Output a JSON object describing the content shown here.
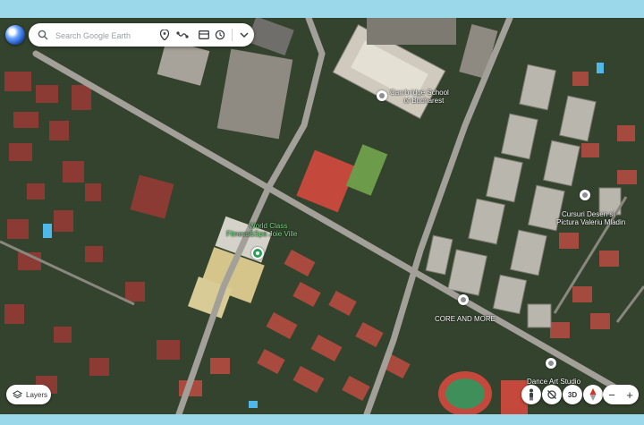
{
  "search": {
    "placeholder": "Search Google Earth"
  },
  "toolbar": {
    "icons": [
      "globe-icon",
      "search-icon",
      "place-marker-icon",
      "route-icon",
      "map-style-icon",
      "history-icon",
      "chevron-down-icon"
    ]
  },
  "places": [
    {
      "name": "Cambridge School\nof Bucharest",
      "line1": "Cambridge School",
      "line2": "of Bucharest",
      "pin": "gray"
    },
    {
      "name": "World Class Fitness&Spa Joie Ville",
      "line1": "World Class",
      "line2": "Fitness&Spa Joie Ville",
      "pin": "green"
    },
    {
      "name": "Cursuri Desen si Pictura Valeriu Mladin",
      "line1": "Cursuri Desen si",
      "line2": "Pictura Valeriu Mladin",
      "pin": "gray"
    },
    {
      "name": "CORE AND MORE",
      "line1": "CORE AND MORE",
      "line2": "",
      "pin": "gray"
    },
    {
      "name": "Dance Art Studio",
      "line1": "Dance Art Studio",
      "line2": "",
      "pin": "gray"
    }
  ],
  "controls": {
    "layers_label": "Layers",
    "view_3d_label": "3D",
    "zoom_out": "−",
    "zoom_in": "+",
    "icons": [
      "pegman-icon",
      "location-off-icon",
      "compass-icon"
    ]
  },
  "colors": {
    "frame": "#9ad8ea",
    "road": "#9e9c97",
    "roof_red": "#b5413a",
    "vegetation": "#2c4a24",
    "court": "#c4483c",
    "place_pin_green": "#2e9f57"
  }
}
